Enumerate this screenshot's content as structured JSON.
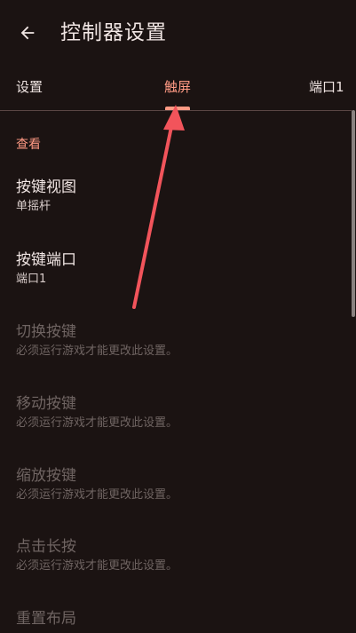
{
  "appbar": {
    "title": "控制器设置",
    "back_icon": "arrow-left-icon"
  },
  "tabs": [
    {
      "label": "设置",
      "active": false
    },
    {
      "label": "触屏",
      "active": true
    },
    {
      "label": "端口1",
      "active": false
    }
  ],
  "colors": {
    "background": "#1b1312",
    "accent": "#ff9a84",
    "annotation_arrow": "#f2545b"
  },
  "section": {
    "title": "查看"
  },
  "preferences": [
    {
      "title": "按键视图",
      "summary": "单摇杆",
      "enabled": true
    },
    {
      "title": "按键端口",
      "summary": "端口1",
      "enabled": true
    },
    {
      "title": "切换按键",
      "summary": "必须运行游戏才能更改此设置。",
      "enabled": false
    },
    {
      "title": "移动按键",
      "summary": "必须运行游戏才能更改此设置。",
      "enabled": false
    },
    {
      "title": "缩放按键",
      "summary": "必须运行游戏才能更改此设置。",
      "enabled": false
    },
    {
      "title": "点击长按",
      "summary": "必须运行游戏才能更改此设置。",
      "enabled": false
    },
    {
      "title": "重置布局",
      "summary": "",
      "enabled": false
    }
  ]
}
